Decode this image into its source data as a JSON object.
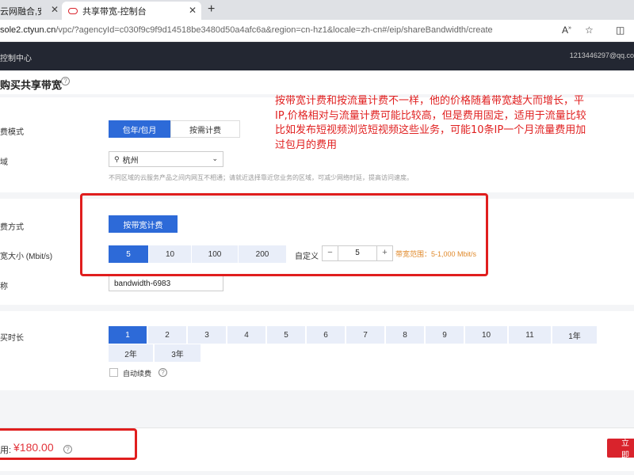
{
  "browser": {
    "tabs": [
      {
        "title": "云网融合,安全可"
      },
      {
        "title": "共享带宽-控制台"
      }
    ],
    "url_host": "sole2.ctyun.cn",
    "url_path": "/vpc/?agencyId=c030f9c9f9d14518be3480d50a4afc6a&region=cn-hz1&locale=zh-cn#/eip/shareBandwidth/create"
  },
  "console": {
    "brand": "控制中心",
    "user": "1213446297@qq.co"
  },
  "page": {
    "title": "购买共享带宽"
  },
  "form": {
    "billing_mode_label": "费模式",
    "billing_modes": [
      "包年/包月",
      "按需计费"
    ],
    "region_label": "域",
    "region_value": "杭州",
    "region_hint": "不同区域的云服务产品之间内网互不相通；请就近选择靠近您业务的区域，可减少网络时延，提高访问速度。",
    "charge_label": "费方式",
    "charge_option": "按带宽计费",
    "bandwidth_label": "宽大小 (Mbit/s)",
    "bandwidth_options": [
      "5",
      "10",
      "100",
      "200"
    ],
    "custom_label": "自定义",
    "custom_minus": "−",
    "custom_value": "5",
    "custom_plus": "+",
    "range_note": "带宽范围：5-1,000 Mbit/s",
    "name_label": "称",
    "name_value": "bandwidth-6983",
    "duration_label": "买时长",
    "duration_row1": [
      "1",
      "2",
      "3",
      "4",
      "5",
      "6",
      "7",
      "8",
      "9",
      "10",
      "11",
      "1年"
    ],
    "duration_row2": [
      "2年",
      "3年"
    ],
    "auto_renew": "自动续费"
  },
  "footer": {
    "price_label": "用:",
    "price": "¥180.00",
    "buy_button": "立即"
  },
  "annotation": {
    "lines": [
      "按带宽计费和按流量计费不一样，他的价格随着带宽越大而增长，平",
      "IP,价格相对与流量计费可能比较高，但是费用固定，适用于流量比较",
      "比如发布短视频浏览短视频这些业务，可能10条IP一个月流量费用加",
      "过包月的费用"
    ]
  },
  "colors": {
    "primary": "#2d6ad8",
    "annotation_red": "#e02020",
    "price_red": "#e2333a",
    "console_dark": "#232732"
  }
}
